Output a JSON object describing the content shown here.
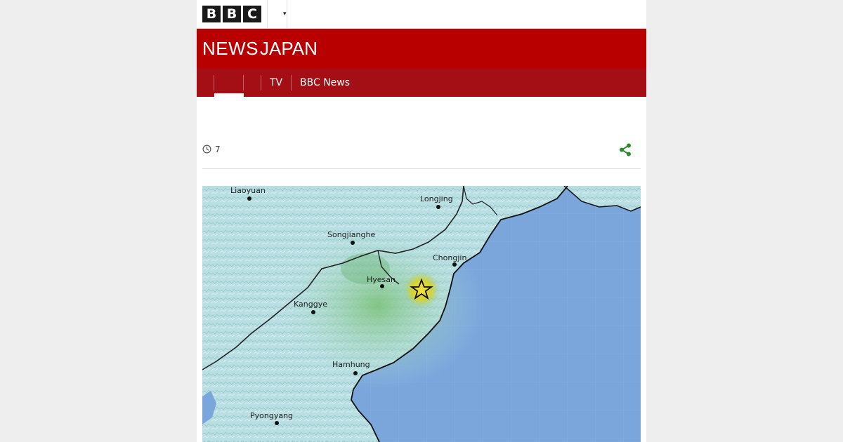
{
  "masthead": {
    "logo_letters": [
      "B",
      "B",
      "C"
    ]
  },
  "brand": {
    "news": "NEWS",
    "region": "JAPAN"
  },
  "nav": {
    "items": [
      {
        "label": ""
      },
      {
        "label": ""
      },
      {
        "label": "TV"
      },
      {
        "label": "BBC News"
      }
    ]
  },
  "article": {
    "timestamp": "7"
  },
  "map": {
    "labels": [
      "Liaoyuan",
      "Longjing",
      "Songjianghe",
      "Chongjin",
      "Hyesan",
      "Kanggye",
      "Hamhung",
      "Pyongyang"
    ],
    "colors": {
      "land": "#b9dfe3",
      "sea": "#7aa6dc",
      "epicenter": "#f2d21a"
    }
  }
}
